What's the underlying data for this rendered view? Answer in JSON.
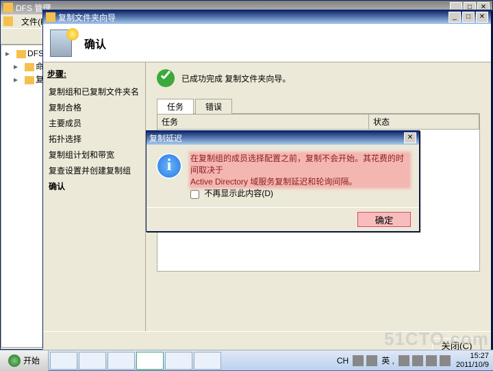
{
  "main_window": {
    "title": "DFS 管理",
    "menu_file": "文件(F)",
    "tree_root": "DFS 管理",
    "tree_node1": "命名",
    "tree_node2": "复制"
  },
  "wizard": {
    "window_title": "复制文件夹向导",
    "heading": "确认",
    "steps_header": "步骤:",
    "steps": [
      "复制组和已复制文件夹名",
      "复制合格",
      "主要成员",
      "拓扑选择",
      "复制组计划和带宽",
      "复查设置并创建复制组",
      "确认"
    ],
    "current_step_index": 6,
    "success_text": "已成功完成 复制文件夹向导。",
    "tab_tasks": "任务",
    "tab_errors": "错误",
    "col_task": "任务",
    "col_status": "状态",
    "close_btn": "关闭(C)"
  },
  "dialog": {
    "title": "复制延迟",
    "message_line1": "在复制组的成员选择配置之前，复制不会开始。其花费的时间取决于",
    "message_line2": "Active Directory 域服务复制延迟和轮询间隔。",
    "checkbox_label": "不再显示此内容(D)",
    "ok_btn": "确定"
  },
  "taskbar": {
    "start_label": "开始",
    "ime_label": "CH",
    "lang_label": "英 ,",
    "time": "15:27",
    "date": "2011/10/9"
  },
  "watermark": "51CTO.com"
}
